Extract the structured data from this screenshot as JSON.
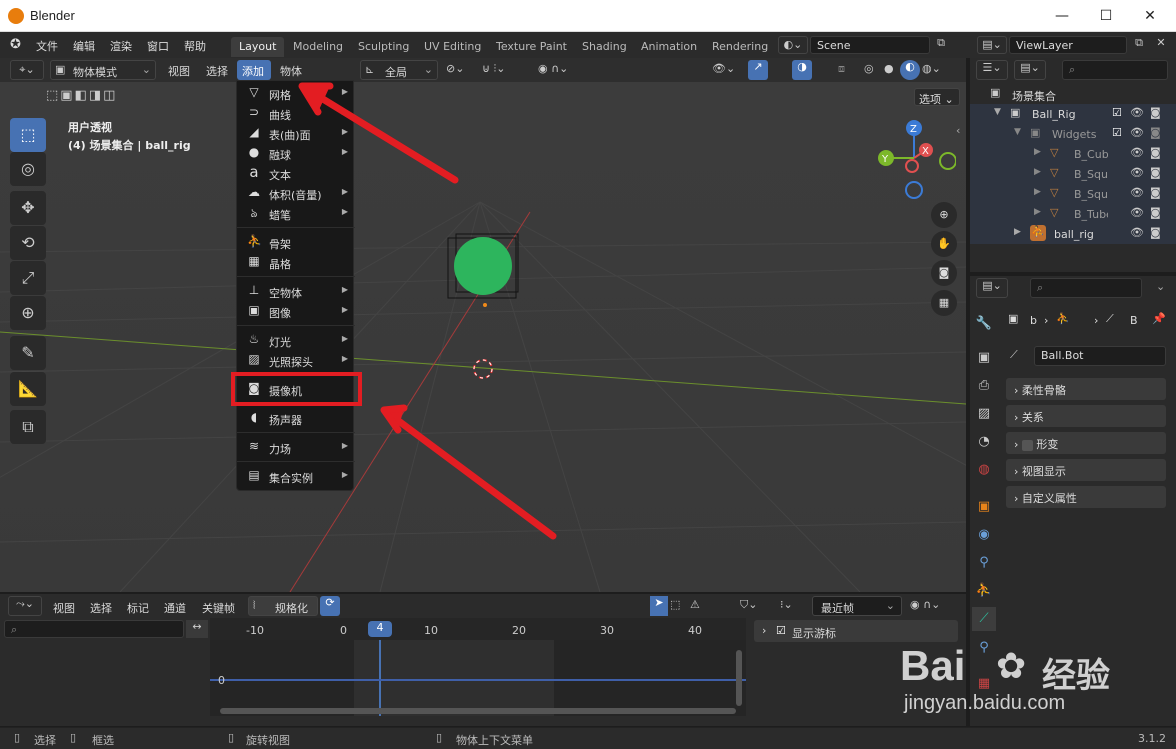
{
  "window": {
    "title": "Blender",
    "minimize": "—",
    "maximize": "☐",
    "close": "✕"
  },
  "topmenu": [
    "文件",
    "编辑",
    "渲染",
    "窗口",
    "帮助"
  ],
  "workspaces": [
    "Layout",
    "Modeling",
    "Sculpting",
    "UV Editing",
    "Texture Paint",
    "Shading",
    "Animation",
    "Rendering"
  ],
  "scene": "Scene",
  "viewlayer": "ViewLayer",
  "header": {
    "mode": "物体模式",
    "view": "视图",
    "select": "选择",
    "add": "添加",
    "object": "物体",
    "transform": "全局",
    "options": "选项"
  },
  "viewport": {
    "line1": "用户透视",
    "line2": "(4) 场景集合 | ball_rig",
    "gizmo": {
      "z": "Z",
      "x": "X",
      "y": "Y"
    }
  },
  "add_menu": {
    "items": [
      {
        "label": "网格",
        "icon": "mesh-icon",
        "glyph": "▽",
        "sub": true
      },
      {
        "label": "曲线",
        "icon": "curve-icon",
        "glyph": "⊃",
        "sub": true
      },
      {
        "label": "表(曲)面",
        "icon": "surface-icon",
        "glyph": "◢",
        "sub": true
      },
      {
        "label": "融球",
        "icon": "metaball-icon",
        "glyph": "●",
        "sub": true
      },
      {
        "label": "文本",
        "icon": "text-icon",
        "glyph": "a",
        "sub": false
      },
      {
        "label": "体积(音量)",
        "icon": "volume-icon",
        "glyph": "☁",
        "sub": true
      },
      {
        "label": "蜡笔",
        "icon": "grease-pencil-icon",
        "glyph": "ঌ",
        "sub": true
      },
      {
        "label": "骨架",
        "icon": "armature-icon",
        "glyph": "⛹",
        "sub": false
      },
      {
        "label": "晶格",
        "icon": "lattice-icon",
        "glyph": "▦",
        "sub": false
      },
      {
        "label": "空物体",
        "icon": "empty-icon",
        "glyph": "⊥",
        "sub": true
      },
      {
        "label": "图像",
        "icon": "image-icon",
        "glyph": "▣",
        "sub": true
      },
      {
        "label": "灯光",
        "icon": "light-icon",
        "glyph": "♨",
        "sub": true
      },
      {
        "label": "光照探头",
        "icon": "light-probe-icon",
        "glyph": "▨",
        "sub": true
      },
      {
        "label": "摄像机",
        "icon": "camera-icon",
        "glyph": "◙",
        "sub": false
      },
      {
        "label": "扬声器",
        "icon": "speaker-icon",
        "glyph": "◖",
        "sub": false
      },
      {
        "label": "力场",
        "icon": "force-field-icon",
        "glyph": "≋",
        "sub": true
      },
      {
        "label": "集合实例",
        "icon": "collection-icon",
        "glyph": "▤",
        "sub": true
      }
    ]
  },
  "outliner": {
    "root": "场景集合",
    "rows": [
      {
        "name": "Ball_Rig",
        "indent": 1
      },
      {
        "name": "Widgets",
        "indent": 2
      },
      {
        "name": "B_Cube",
        "indent": 3
      },
      {
        "name": "B_Squa",
        "indent": 3
      },
      {
        "name": "B_Squa",
        "indent": 3
      },
      {
        "name": "B_Tube",
        "indent": 3
      },
      {
        "name": "ball_rig",
        "indent": 2
      }
    ]
  },
  "properties": {
    "path_b": "b",
    "path_B": "B",
    "bone_name": "Ball.Bot",
    "panels": [
      "柔性骨骼",
      "关系",
      "形变",
      "视图显示",
      "自定义属性"
    ]
  },
  "timeline": {
    "menus": [
      "视图",
      "选择",
      "标记",
      "通道",
      "关键帧"
    ],
    "normalize": "规格化",
    "interp": "最近帧",
    "frames": [
      "-10",
      "0",
      "10",
      "20",
      "30",
      "40"
    ],
    "current": "4",
    "zero": "0",
    "show_cursor": "显示游标"
  },
  "status": {
    "select": "选择",
    "box": "框选",
    "rotate": "旋转视图",
    "context": "物体上下文菜单",
    "version": "3.1.2"
  },
  "watermark": {
    "brand": "Bai",
    "brand2": "经验",
    "url": "jingyan.baidu.com"
  },
  "colors": {
    "accent": "#4772b3",
    "highlight": "#e31d22",
    "sphere": "#2db55d"
  }
}
